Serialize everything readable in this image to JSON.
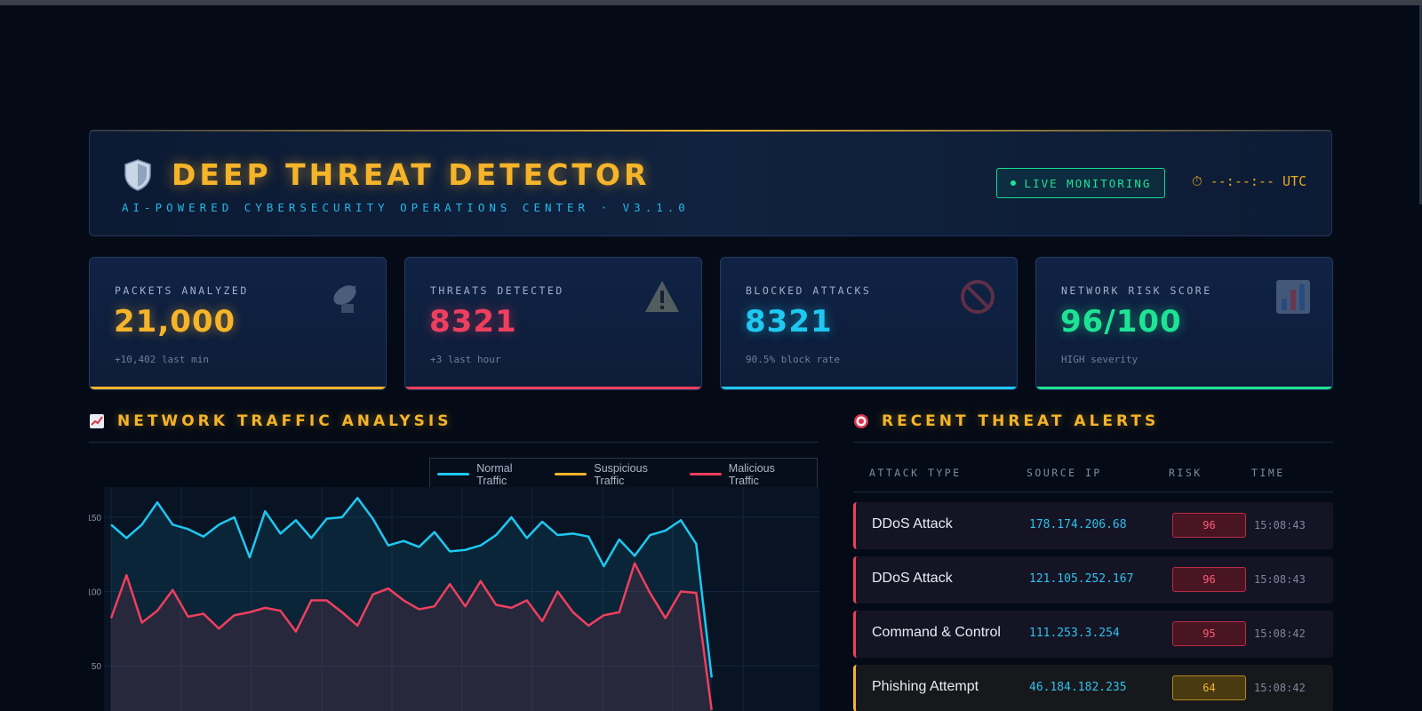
{
  "header": {
    "title": "DEEP THREAT DETECTOR",
    "subtitle": "AI-POWERED CYBERSECURITY OPERATIONS CENTER  ·  V3.1.0",
    "live_label": "LIVE MONITORING",
    "clock": "⏱ --:--:-- UTC",
    "logo_icon": "shield-icon"
  },
  "stats": [
    {
      "label": "PACKETS ANALYZED",
      "value": "21,000",
      "sub": "+10,402 last min",
      "color": "#f5b429",
      "icon": "satellite-dish-icon"
    },
    {
      "label": "THREATS DETECTED",
      "value": "8321",
      "sub": "+3 last hour",
      "color": "#ef3f5f",
      "icon": "warning-icon"
    },
    {
      "label": "BLOCKED ATTACKS",
      "value": "8321",
      "sub": "90.5% block rate",
      "color": "#1ec8f0",
      "icon": "prohibited-icon"
    },
    {
      "label": "NETWORK RISK SCORE",
      "value": "96/100",
      "sub": "HIGH severity",
      "color": "#1de394",
      "icon": "bar-chart-icon"
    }
  ],
  "traffic": {
    "title": "NETWORK TRAFFIC ANALYSIS",
    "icon": "trend-chart-icon"
  },
  "alerts": {
    "title": "RECENT THREAT ALERTS",
    "icon": "target-icon",
    "columns": [
      "ATTACK TYPE",
      "SOURCE IP",
      "RISK",
      "TIME"
    ],
    "rows": [
      {
        "type": "DDoS Attack",
        "ip": "178.174.206.68",
        "risk": "96",
        "time": "15:08:43",
        "level": "high"
      },
      {
        "type": "DDoS Attack",
        "ip": "121.105.252.167",
        "risk": "96",
        "time": "15:08:43",
        "level": "high"
      },
      {
        "type": "Command & Control",
        "ip": "111.253.3.254",
        "risk": "95",
        "time": "15:08:42",
        "level": "high"
      },
      {
        "type": "Phishing Attempt",
        "ip": "46.184.182.235",
        "risk": "64",
        "time": "15:08:42",
        "level": "med"
      }
    ]
  },
  "colors": {
    "accent": "#f5b429",
    "normal": "#1ec8f0",
    "suspicious": "#f5b429",
    "malicious": "#ef3f5f",
    "live": "#1de394"
  },
  "chart_data": {
    "type": "line",
    "legend": [
      "Normal Traffic",
      "Suspicious Traffic",
      "Malicious Traffic"
    ],
    "ytick_labels": [
      "150",
      "100",
      "50"
    ],
    "yticks": [
      150,
      100,
      50
    ],
    "x": [
      0,
      1,
      2,
      3,
      4,
      5,
      6,
      7,
      8,
      9,
      10,
      11,
      12,
      13,
      14,
      15,
      16,
      17,
      18,
      19,
      20,
      21,
      22,
      23,
      24,
      25,
      26,
      27,
      28,
      29,
      30,
      31,
      32,
      33,
      34,
      35,
      36,
      37,
      38,
      39,
      40,
      41,
      42,
      43,
      44,
      45,
      46
    ],
    "series": [
      {
        "name": "Normal Traffic",
        "color": "#1ec8f0",
        "values": [
          145,
          136,
          145,
          160,
          145,
          142,
          137,
          145,
          150,
          123,
          154,
          139,
          148,
          136,
          149,
          150,
          163,
          149,
          131,
          134,
          130,
          140,
          127,
          128,
          131,
          138,
          150,
          136,
          147,
          138,
          139,
          137,
          117,
          135,
          124,
          138,
          141,
          148,
          132,
          42,
          null,
          null,
          null,
          null,
          null,
          null,
          null
        ]
      },
      {
        "name": "Suspicious Traffic",
        "color": "#f5b429",
        "values": []
      },
      {
        "name": "Malicious Traffic",
        "color": "#ef3f5f",
        "values": [
          82,
          111,
          79,
          87,
          101,
          83,
          85,
          75,
          84,
          86,
          89,
          87,
          73,
          94,
          94,
          86,
          77,
          98,
          102,
          94,
          88,
          90,
          105,
          90,
          107,
          91,
          89,
          94,
          80,
          100,
          86,
          77,
          84,
          86,
          119,
          99,
          82,
          100,
          99,
          20,
          null,
          null,
          null,
          null,
          null,
          null,
          null
        ]
      }
    ]
  }
}
